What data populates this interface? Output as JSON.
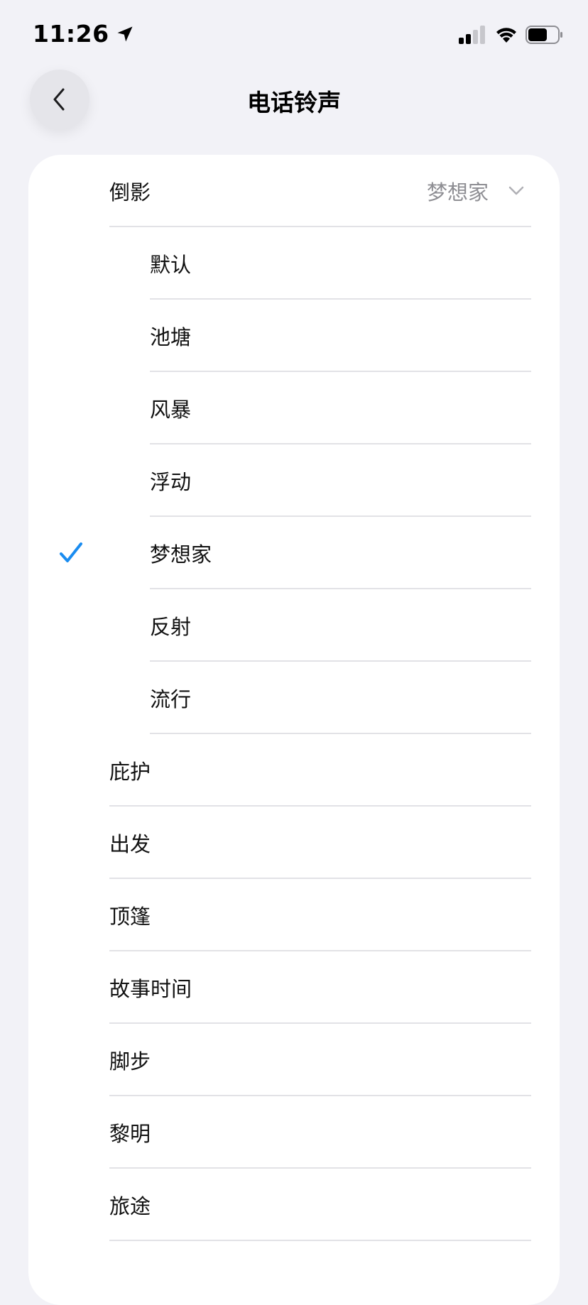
{
  "status_bar": {
    "time": "11:26"
  },
  "header": {
    "title": "电话铃声"
  },
  "group": {
    "label": "倒影",
    "selected_value": "梦想家",
    "items": [
      {
        "label": "默认",
        "selected": false
      },
      {
        "label": "池塘",
        "selected": false
      },
      {
        "label": "风暴",
        "selected": false
      },
      {
        "label": "浮动",
        "selected": false
      },
      {
        "label": "梦想家",
        "selected": true
      },
      {
        "label": "反射",
        "selected": false
      },
      {
        "label": "流行",
        "selected": false
      }
    ]
  },
  "ringtones": [
    {
      "label": "庇护"
    },
    {
      "label": "出发"
    },
    {
      "label": "顶篷"
    },
    {
      "label": "故事时间"
    },
    {
      "label": "脚步"
    },
    {
      "label": "黎明"
    },
    {
      "label": "旅途"
    }
  ],
  "colors": {
    "accent": "#1a8cf0",
    "background": "#f2f2f7",
    "card": "#ffffff",
    "secondary_text": "#8e8e93"
  }
}
